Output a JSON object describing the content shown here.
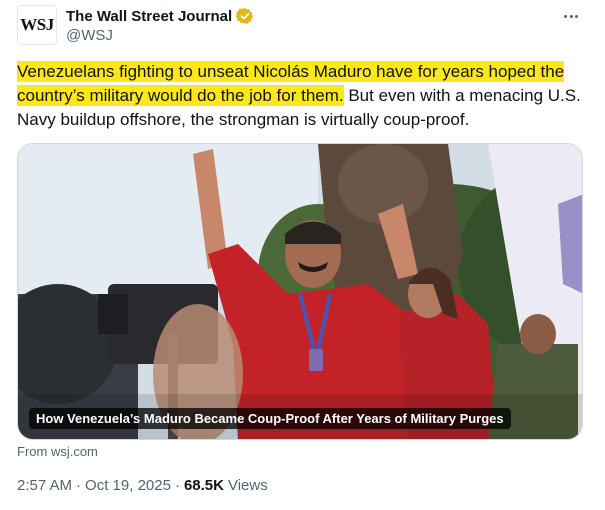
{
  "account": {
    "avatar_text": "WSJ",
    "display_name": "The Wall Street Journal",
    "handle": "@WSJ"
  },
  "tweet": {
    "highlighted_text": "Venezuelans fighting to unseat Nicolás Maduro have for years hoped the country’s military would do the job for them.",
    "rest_text": " But even with a menacing U.S. Navy buildup offshore, the strongman is virtually coup-proof."
  },
  "card": {
    "caption": "How Venezuela’s Maduro Became Coup-Proof After Years of Military Purges",
    "source": "From wsj.com"
  },
  "meta": {
    "time": "2:57 AM",
    "date": "Oct 19, 2025",
    "separator": "·",
    "views_count": "68.5K",
    "views_label": "Views"
  },
  "colors": {
    "highlight": "#ffe81a",
    "verified_badge": "#e2b719",
    "secondary_text": "#536471"
  },
  "icons": [
    "verified-badge-icon",
    "more-options-icon"
  ]
}
